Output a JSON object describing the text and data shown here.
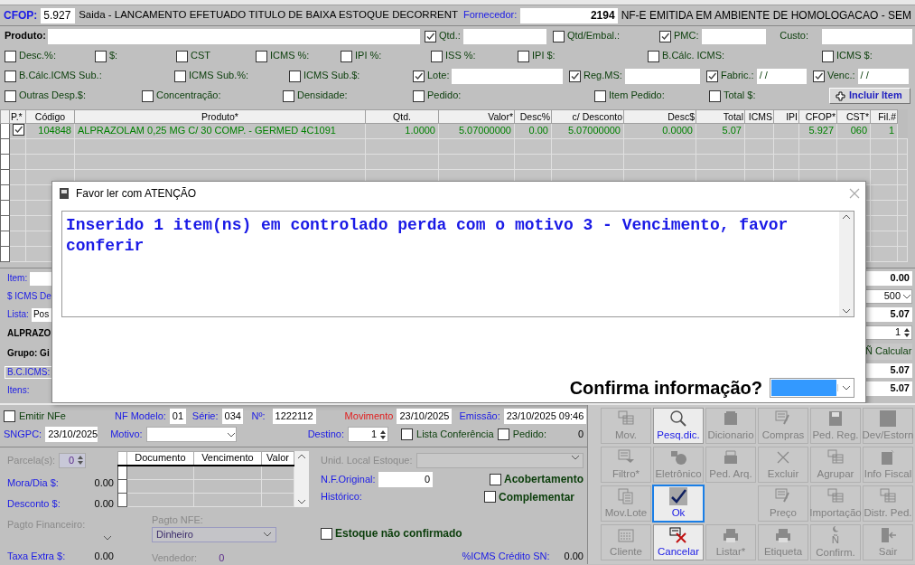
{
  "header": {
    "cfop_label": "CFOP:",
    "cfop": "5.927",
    "cfop_description": "Saida - LANCAMENTO EFETUADO TITULO DE BAIXA ESTOQUE DECORRENT",
    "supplier_label": "Fornecedor:",
    "supplier": "2194",
    "supplier_name": "NF-E EMITIDA EM AMBIENTE DE HOMOLOGACAO - SEM"
  },
  "product": {
    "label": "Produto:"
  },
  "option_rows": [
    [
      {
        "kind": "check_field",
        "label": "Qtd.:",
        "checked": true
      },
      {
        "kind": "check",
        "label": "Qtd/Embal.:",
        "checked": false
      },
      {
        "kind": "check_field",
        "label": "PMC:",
        "checked": true
      },
      {
        "kind": "field",
        "label": "Custo:"
      }
    ],
    [
      {
        "kind": "check",
        "label": "Desc.%:",
        "checked": false
      },
      {
        "kind": "check",
        "label": "$:",
        "checked": false
      },
      {
        "kind": "check",
        "label": "CST",
        "checked": false
      },
      {
        "kind": "check",
        "label": "ICMS %:",
        "checked": false
      },
      {
        "kind": "check",
        "label": "IPI %:",
        "checked": false
      },
      {
        "kind": "check",
        "label": "ISS %:",
        "checked": false
      },
      {
        "kind": "check",
        "label": "IPI $:",
        "checked": false
      },
      {
        "kind": "check",
        "label": "B.Cálc. ICMS:",
        "checked": false
      },
      {
        "kind": "check",
        "label": "ICMS $:",
        "checked": false
      }
    ],
    [
      {
        "kind": "check",
        "label": "B.Cálc.ICMS Sub.:",
        "checked": false
      },
      {
        "kind": "check",
        "label": "ICMS Sub.%:",
        "checked": false
      },
      {
        "kind": "check",
        "label": "ICMS Sub.$:",
        "checked": false
      },
      {
        "kind": "check_field",
        "label": "Lote:",
        "checked": true
      },
      {
        "kind": "check_field",
        "label": "Reg.MS:",
        "checked": true
      },
      {
        "kind": "check_field",
        "label": "Fabric.:",
        "checked": true,
        "value": " / /"
      },
      {
        "kind": "check_field",
        "label": "Venc.:",
        "checked": true,
        "value": " / /"
      }
    ],
    [
      {
        "kind": "check",
        "label": "Outras Desp.$:",
        "checked": false
      },
      {
        "kind": "check",
        "label": "Concentração:",
        "checked": false
      },
      {
        "kind": "check",
        "label": "Densidade:",
        "checked": false
      },
      {
        "kind": "check",
        "label": "Pedido:",
        "checked": false
      },
      {
        "kind": "check",
        "label": "Item Pedido:",
        "checked": false
      },
      {
        "kind": "check",
        "label": "Total $:",
        "checked": false
      },
      {
        "kind": "button",
        "label": "Incluir Item"
      }
    ]
  ],
  "grid": {
    "columns": [
      "P.*",
      "Código",
      "Produto*",
      "Qtd.",
      "Valor*",
      "Desc%",
      "c/ Desconto",
      "Desc$",
      "Total",
      "ICMS",
      "IPI",
      "CFOP*",
      "CST*",
      "Fil.#"
    ],
    "rows": [
      {
        "checked": true,
        "cells": [
          "",
          "104848",
          "ALPRAZOLAM 0,25 MG C/ 30 COMP. - GERMED 4C1091",
          "1.0000",
          "5.07000000",
          "0.00",
          "5.07000000",
          "0.0000",
          "5.07",
          "",
          "",
          "5.927",
          "060",
          "1"
        ]
      }
    ]
  },
  "behind_left": [
    {
      "kind": "label_field",
      "label": "Item:"
    },
    {
      "kind": "label",
      "label": "$ ICMS De"
    },
    {
      "kind": "label_field",
      "label": "Lista:",
      "value": "Pos"
    },
    {
      "kind": "bold",
      "label": "ALPRAZO"
    },
    {
      "kind": "bold",
      "label": "Grupo: Gi"
    },
    {
      "kind": "boxed",
      "label": "B.C.ICMS:"
    },
    {
      "kind": "label",
      "label": "Itens:"
    }
  ],
  "behind_right": [
    {
      "kind": "field",
      "value": "0.00"
    },
    {
      "kind": "select",
      "value": "500"
    },
    {
      "kind": "field",
      "value": "5.07"
    },
    {
      "kind": "spinner",
      "value": "1"
    },
    {
      "kind": "button",
      "label": "Ñ Calcular"
    },
    {
      "kind": "field",
      "value": "5.07"
    },
    {
      "kind": "field",
      "value": "5.07"
    }
  ],
  "dialog": {
    "title": "Favor ler com ATENÇÃO",
    "message": "Inserido 1 item(ns) em controlado perda com o motivo 3 - Vencimento, favor conferir",
    "question": "Confirma informação?",
    "answer_focused": true
  },
  "document": {
    "emit_nfe": {
      "label": "Emitir NFe",
      "checked": false
    },
    "nf_model": {
      "label": "NF Modelo:",
      "value": "01"
    },
    "series": {
      "label": "Série:",
      "value": "034"
    },
    "number": {
      "label": "Nº:",
      "value": "1222112"
    },
    "movement": {
      "label": "Movimento",
      "value": "23/10/2025"
    },
    "issue": {
      "label": "Emissão:",
      "value": "23/10/2025 09:46"
    },
    "sngpc": {
      "label": "SNGPC:",
      "value": "23/10/2025"
    },
    "reason": {
      "label": "Motivo:"
    },
    "destination": {
      "label": "Destino:",
      "value": "1"
    },
    "check_list": {
      "label": "Lista Conferência",
      "checked": false
    },
    "order": {
      "label": "Pedido:",
      "checked": false
    },
    "order_value": "0"
  },
  "payment": {
    "installments": {
      "label": "Parcela(s):",
      "value": "0",
      "disabled": true
    },
    "interest": {
      "label": "Mora/Dia $:",
      "value": "0.00"
    },
    "discount": {
      "label": "Desconto $:",
      "value": "0.00"
    },
    "financial_payment": {
      "label": "Pagto Financeiro:",
      "disabled": true
    },
    "extra_fee": {
      "label": "Taxa Extra $:",
      "value": "0.00"
    },
    "installment_columns": [
      "Documento",
      "Vencimento",
      "Valor"
    ],
    "nfe_payment": {
      "label": "Pagto NFE:",
      "value": "Dinheiro",
      "disabled": true
    },
    "seller": {
      "label": "Vendedor:",
      "value": "0",
      "disabled": true
    },
    "stock_unit": {
      "label": "Unid. Local Estoque:",
      "disabled": true
    },
    "original_nf": {
      "label": "N.F.Original:",
      "value": "0"
    },
    "covering": {
      "label": "Acobertamento",
      "checked": false
    },
    "history": {
      "label": "Histórico:"
    },
    "complementary": {
      "label": "Complementar",
      "checked": false
    },
    "stock_unconfirmed": {
      "label": "Estoque não confirmado",
      "checked": false
    },
    "icms_credit": {
      "label": "%ICMS Crédito SN:",
      "value": "0.00"
    }
  },
  "toolbar": [
    {
      "kind": "button",
      "label": "Mov.",
      "disabled": true,
      "focused": false
    },
    {
      "kind": "button",
      "label": "Pesq.dic.",
      "disabled": false,
      "focused": false
    },
    {
      "kind": "button",
      "label": "Dicionario",
      "disabled": true,
      "focused": false
    },
    {
      "kind": "button",
      "label": "Compras",
      "disabled": true,
      "focused": false
    },
    {
      "kind": "button",
      "label": "Ped. Reg.",
      "disabled": true,
      "focused": false
    },
    {
      "kind": "button",
      "label": "Dev/Estorn",
      "disabled": true,
      "focused": false
    },
    {
      "kind": "button",
      "label": "Filtro*",
      "disabled": true,
      "focused": false
    },
    {
      "kind": "button",
      "label": "Eletrônico",
      "disabled": true,
      "focused": false
    },
    {
      "kind": "button",
      "label": "Ped. Arq.",
      "disabled": true,
      "focused": false
    },
    {
      "kind": "button",
      "label": "Excluir",
      "disabled": true,
      "focused": false
    },
    {
      "kind": "button",
      "label": "Agrupar",
      "disabled": true,
      "focused": false
    },
    {
      "kind": "button",
      "label": "Info Fiscal",
      "disabled": true,
      "focused": false
    },
    {
      "kind": "button",
      "label": "Mov.Lote",
      "disabled": true,
      "focused": false
    },
    {
      "kind": "button",
      "label": "Ok",
      "disabled": false,
      "focused": true
    },
    {
      "kind": "blank"
    },
    {
      "kind": "button",
      "label": "Preço",
      "disabled": true,
      "focused": false
    },
    {
      "kind": "button",
      "label": "Importação",
      "disabled": true,
      "focused": false
    },
    {
      "kind": "button",
      "label": "Distr. Ped.",
      "disabled": true,
      "focused": false
    },
    {
      "kind": "button",
      "label": "Cliente",
      "disabled": true,
      "focused": false
    },
    {
      "kind": "button",
      "label": "Cancelar",
      "disabled": false,
      "focused": false
    },
    {
      "kind": "button",
      "label": "Listar*",
      "disabled": true,
      "focused": false
    },
    {
      "kind": "button",
      "label": "Etiqueta",
      "disabled": true,
      "focused": false
    },
    {
      "kind": "button",
      "label": "Ñ Confirm.",
      "disabled": true,
      "focused": false
    },
    {
      "kind": "button",
      "label": "Sair",
      "disabled": true,
      "focused": false
    }
  ]
}
